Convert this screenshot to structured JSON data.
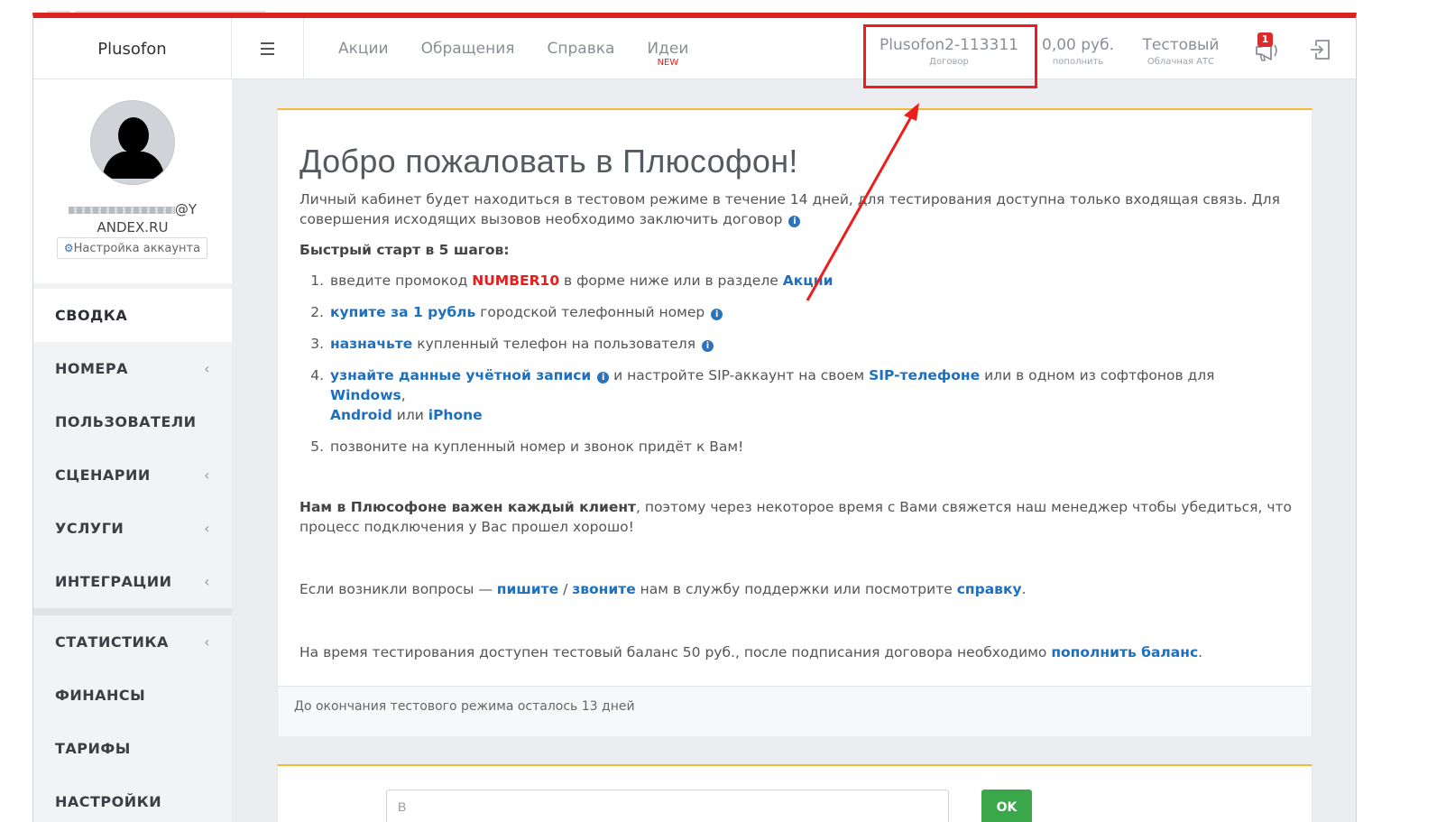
{
  "header": {
    "brand": "Plusofon",
    "nav": [
      {
        "label": "Акции",
        "tag": ""
      },
      {
        "label": "Обращения",
        "tag": ""
      },
      {
        "label": "Справка",
        "tag": ""
      },
      {
        "label": "Идеи",
        "tag": "NEW"
      }
    ],
    "contract": {
      "value": "Plusofon2-113311",
      "label": "Договор"
    },
    "balance": {
      "value": "0,00 руб.",
      "label": "пополнить"
    },
    "tariff": {
      "value": "Тестовый",
      "label": "Облачная АТС"
    },
    "notifications_count": "1"
  },
  "sidebar": {
    "email_line1": "@Y",
    "email_line2": "ANDEX.RU",
    "account_settings": "Настройка аккаунта",
    "menu": [
      {
        "label": "СВОДКА",
        "has_chevron": false
      },
      {
        "label": "НОМЕРА",
        "has_chevron": true
      },
      {
        "label": "ПОЛЬЗОВАТЕЛИ",
        "has_chevron": false
      },
      {
        "label": "СЦЕНАРИИ",
        "has_chevron": true
      },
      {
        "label": "УСЛУГИ",
        "has_chevron": true
      },
      {
        "label": "ИНТЕГРАЦИИ",
        "has_chevron": true
      },
      {
        "label": "СТАТИСТИКА",
        "has_chevron": true
      },
      {
        "label": "ФИНАНСЫ",
        "has_chevron": false
      },
      {
        "label": "ТАРИФЫ",
        "has_chevron": false
      },
      {
        "label": "НАСТРОЙКИ",
        "has_chevron": false
      }
    ],
    "chevron": "‹"
  },
  "welcome": {
    "title": "Добро пожаловать в Плюсофон!",
    "intro": "Личный кабинет будет находиться в тестовом режиме в течение 14 дней, для тестирования доступна только входящая связь. Для совершения исходящих вызовов необходимо заключить договор",
    "quickstart": "Быстрый старт в 5 шагов:",
    "step1": {
      "a": "введите промокод ",
      "promo": "NUMBER10",
      "b": " в форме ниже или в разделе ",
      "link": "Акции"
    },
    "step2": {
      "link": "купите за 1 рубль",
      "b": " городской телефонный номер"
    },
    "step3": {
      "link": "назначьте",
      "b": " купленный телефон на пользователя"
    },
    "step4": {
      "link": "узнайте данные учётной записи",
      "b": " и настройте SIP-аккаунт на своем ",
      "link2": "SIP-телефоне",
      "c": " или в одном из софтфонов для ",
      "link3": "Windows",
      "d": ",",
      "link4": "Android",
      "e": " или ",
      "link5": "iPhone"
    },
    "step5": "позвоните на купленный номер и звонок придёт к Вам!",
    "client_bold": "Нам в Плюсофоне важен каждый клиент",
    "client_rest": ", поэтому через некоторое время с Вами свяжется наш менеджер чтобы убедиться, что процесс подключения у Вас прошел хорошо!",
    "questions": {
      "a": "Если возникли вопросы — ",
      "write": "пишите",
      "sep": " / ",
      "call": "звоните",
      "b": " нам в службу поддержки или посмотрите ",
      "help": "справку",
      "c": "."
    },
    "balance": {
      "a": "На время тестирования доступен тестовый баланс 50 руб., после подписания договора необходимо ",
      "link": "пополнить баланс",
      "b": "."
    },
    "footer": "До окончания тестового режима осталось 13 дней"
  },
  "promo_form": {
    "placeholder": "В",
    "button": "OK"
  },
  "colors": {
    "accent_red": "#dd2222",
    "link_blue": "#1f6fbf",
    "warning_yellow": "#f3b935",
    "ok_green": "#3aa84a"
  },
  "icons": [
    "menu-icon",
    "megaphone-icon",
    "logout-icon",
    "info-icon",
    "gear-icon",
    "user-avatar-icon"
  ]
}
